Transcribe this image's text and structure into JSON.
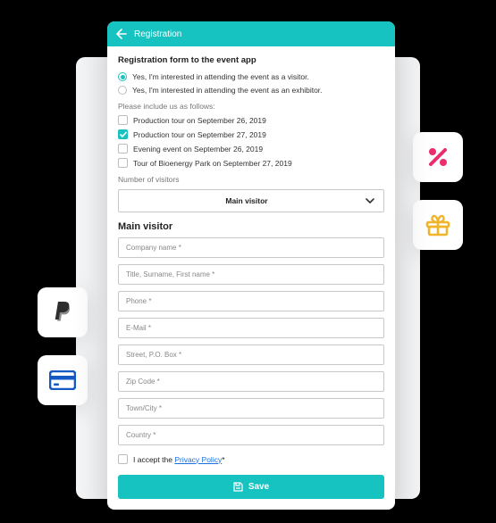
{
  "appbar": {
    "title": "Registration"
  },
  "form": {
    "title": "Registration form to the event app",
    "radios": [
      {
        "label": "Yes, I'm interested in attending the event as a visitor.",
        "selected": true
      },
      {
        "label": "Yes, I'm interested in attending the event as an exhibitor.",
        "selected": false
      }
    ],
    "includeLabel": "Please include us as follows:",
    "checks": [
      {
        "label": "Production tour on September 26, 2019",
        "checked": false
      },
      {
        "label": "Production tour on September 27, 2019",
        "checked": true
      },
      {
        "label": "Evening event on September 26, 2019",
        "checked": false
      },
      {
        "label": "Tour of Bioenergy Park on September 27, 2019",
        "checked": false
      }
    ],
    "visitorsLabel": "Number of visitors",
    "visitorSelect": "Main visitor",
    "sectionTitle": "Main visitor",
    "fields": [
      "Company name *",
      "Title, Surname, First name *",
      "Phone *",
      "E-Mail *",
      "Street, P.O. Box *",
      "Zip Code *",
      "Town/City *",
      "Country *"
    ],
    "acceptPrefix": "I accept the ",
    "acceptLink": "Privacy Policy",
    "acceptSuffix": "*",
    "saveLabel": "Save"
  },
  "icons": {
    "percentColor": "#ec2c6e",
    "giftColor": "#f0b429",
    "cardColor": "#1759c4",
    "paypalColor": "#2e2e2e"
  }
}
